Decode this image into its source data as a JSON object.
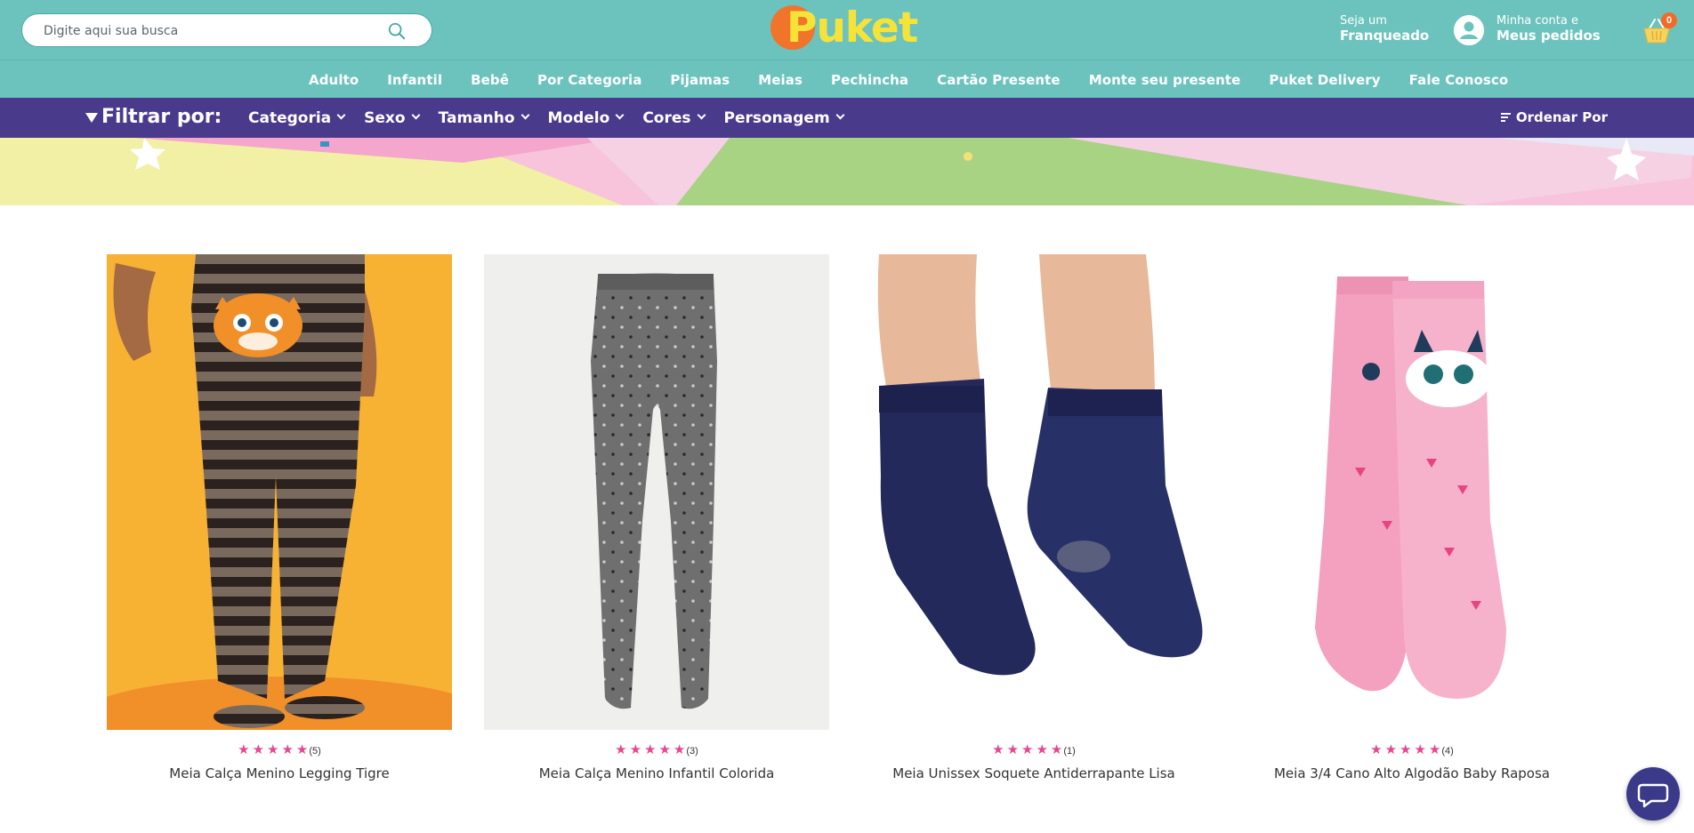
{
  "search": {
    "placeholder": "Digite aqui sua busca"
  },
  "logo": {
    "text": "Puket"
  },
  "franchise": {
    "line1": "Seja um",
    "line2": "Franqueado"
  },
  "account": {
    "line1": "Minha conta e",
    "line2": "Meus pedidos"
  },
  "cart": {
    "count": "0"
  },
  "categories": [
    "Adulto",
    "Infantil",
    "Bebê",
    "Por Categoria",
    "Pijamas",
    "Meias",
    "Pechincha",
    "Cartão Presente",
    "Monte seu presente",
    "Puket Delivery",
    "Fale Conosco"
  ],
  "filters": {
    "title": "Filtrar por:",
    "items": [
      "Categoria",
      "Sexo",
      "Tamanho",
      "Modelo",
      "Cores",
      "Personagem"
    ],
    "sort": "Ordenar Por"
  },
  "products": [
    {
      "name": "Meia Calça Menino Legging Tigre",
      "reviews": "(5)",
      "rating": 5
    },
    {
      "name": "Meia Calça Menino Infantil Colorida",
      "reviews": "(3)",
      "rating": 5
    },
    {
      "name": "Meia Unissex Soquete Antiderrapante Lisa",
      "reviews": "(1)",
      "rating": 5
    },
    {
      "name": "Meia 3/4 Cano Alto Algodão Baby Raposa",
      "reviews": "(4)",
      "rating": 5
    }
  ],
  "colors": {
    "header": "#6cc3bd",
    "filterbar": "#4a3a8c",
    "star": "#e8468f",
    "logo_dot": "#f0742a",
    "logo_text": "#f5e33a"
  },
  "icons": {
    "search": "search-icon",
    "account": "user-icon",
    "cart": "basket-icon",
    "chat": "chat-icon",
    "filter": "funnel-icon",
    "sort": "sort-icon"
  }
}
